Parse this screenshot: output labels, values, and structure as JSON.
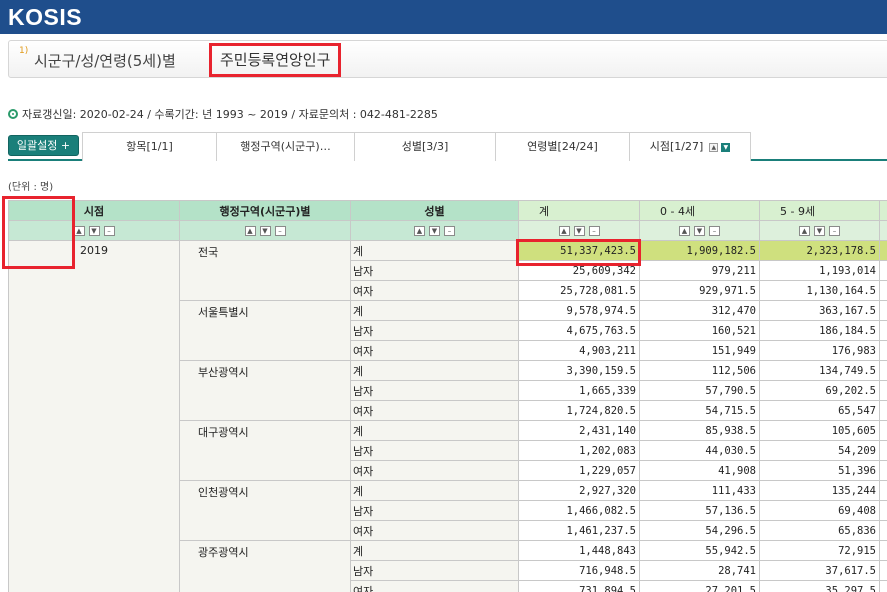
{
  "header": {
    "logo": "KOSIS"
  },
  "title": {
    "num": "1)",
    "prefix": "시군구/성/연령(5세)별",
    "main": "주민등록연앙인구"
  },
  "info": {
    "text": "자료갱신일: 2020-02-24 / 수록기간: 년 1993 ~ 2019 / 자료문의처 : 042-481-2285"
  },
  "toolbar": {
    "setting_label": "일괄설정 +",
    "tabs": [
      "항목[1/1]",
      "행정구역(시군구)…",
      "성별[3/3]",
      "연령별[24/24]",
      "시점[1/27]"
    ]
  },
  "unit": "(단위 : 명)",
  "table": {
    "headers": {
      "time": "시점",
      "region": "행정구역(시군구)별",
      "sex": "성별"
    },
    "value_headers": [
      "계",
      "0 - 4세",
      "5 - 9세"
    ],
    "year": "2019",
    "groups": [
      {
        "region": "전국",
        "rows": [
          {
            "sex": "계",
            "v": [
              "51,337,423.5",
              "1,909,182.5",
              "2,323,178.5"
            ]
          },
          {
            "sex": "남자",
            "v": [
              "25,609,342",
              "979,211",
              "1,193,014"
            ]
          },
          {
            "sex": "여자",
            "v": [
              "25,728,081.5",
              "929,971.5",
              "1,130,164.5"
            ]
          }
        ]
      },
      {
        "region": "서울특별시",
        "rows": [
          {
            "sex": "계",
            "v": [
              "9,578,974.5",
              "312,470",
              "363,167.5"
            ]
          },
          {
            "sex": "남자",
            "v": [
              "4,675,763.5",
              "160,521",
              "186,184.5"
            ]
          },
          {
            "sex": "여자",
            "v": [
              "4,903,211",
              "151,949",
              "176,983"
            ]
          }
        ]
      },
      {
        "region": "부산광역시",
        "rows": [
          {
            "sex": "계",
            "v": [
              "3,390,159.5",
              "112,506",
              "134,749.5"
            ]
          },
          {
            "sex": "남자",
            "v": [
              "1,665,339",
              "57,790.5",
              "69,202.5"
            ]
          },
          {
            "sex": "여자",
            "v": [
              "1,724,820.5",
              "54,715.5",
              "65,547"
            ]
          }
        ]
      },
      {
        "region": "대구광역시",
        "rows": [
          {
            "sex": "계",
            "v": [
              "2,431,140",
              "85,938.5",
              "105,605"
            ]
          },
          {
            "sex": "남자",
            "v": [
              "1,202,083",
              "44,030.5",
              "54,209"
            ]
          },
          {
            "sex": "여자",
            "v": [
              "1,229,057",
              "41,908",
              "51,396"
            ]
          }
        ]
      },
      {
        "region": "인천광역시",
        "rows": [
          {
            "sex": "계",
            "v": [
              "2,927,320",
              "111,433",
              "135,244"
            ]
          },
          {
            "sex": "남자",
            "v": [
              "1,466,082.5",
              "57,136.5",
              "69,408"
            ]
          },
          {
            "sex": "여자",
            "v": [
              "1,461,237.5",
              "54,296.5",
              "65,836"
            ]
          }
        ]
      },
      {
        "region": "광주광역시",
        "rows": [
          {
            "sex": "계",
            "v": [
              "1,448,843",
              "55,942.5",
              "72,915"
            ]
          },
          {
            "sex": "남자",
            "v": [
              "716,948.5",
              "28,741",
              "37,617.5"
            ]
          },
          {
            "sex": "여자",
            "v": [
              "731,894.5",
              "27,201.5",
              "35,297.5"
            ]
          }
        ]
      }
    ]
  },
  "colors": {
    "topbar": "#1f4e8c",
    "accent": "#1a7f7a",
    "highlight_box": "#e8232e",
    "highlight_cell": "#cfe07e"
  }
}
